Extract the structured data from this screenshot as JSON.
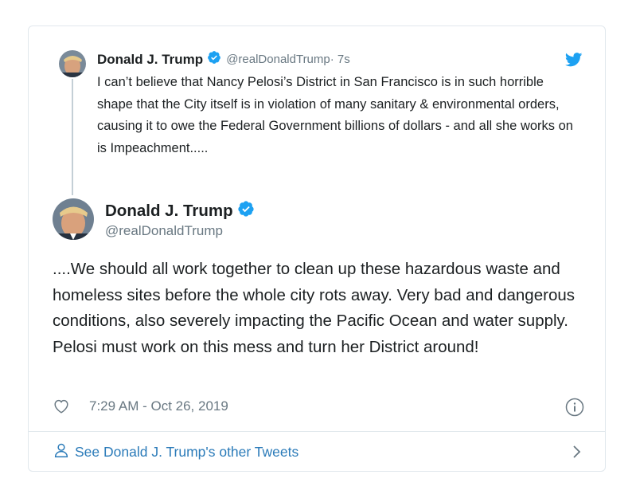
{
  "colors": {
    "accent": "#1da1f2",
    "link": "#2b7bb9",
    "muted": "#697882",
    "border": "#e1e8ed",
    "text": "#1c2022"
  },
  "parent_tweet": {
    "author_name": "Donald J. Trump",
    "handle": "@realDonaldTrump",
    "time": " · 7s",
    "text": "I can’t believe that Nancy Pelosi’s District in San Francisco is in such horrible shape that the City itself is in violation of many sanitary & environmental orders, causing it to owe the Federal Government billions of dollars - and all she works on is Impeachment....."
  },
  "main_tweet": {
    "author_name": "Donald J. Trump",
    "handle": "@realDonaldTrump",
    "text": "....We should all work together to clean up these hazardous waste and homeless sites before the whole city rots away. Very bad and dangerous conditions, also severely impacting the Pacific Ocean and water supply. Pelosi must work on this mess and turn her District around!",
    "timestamp": "7:29 AM - Oct 26, 2019"
  },
  "footer": {
    "see_more_label": "See Donald J. Trump's other Tweets"
  },
  "icons": [
    "verified-badge-icon",
    "twitter-bird-icon",
    "heart-icon",
    "info-icon",
    "person-icon",
    "chevron-right-icon"
  ]
}
